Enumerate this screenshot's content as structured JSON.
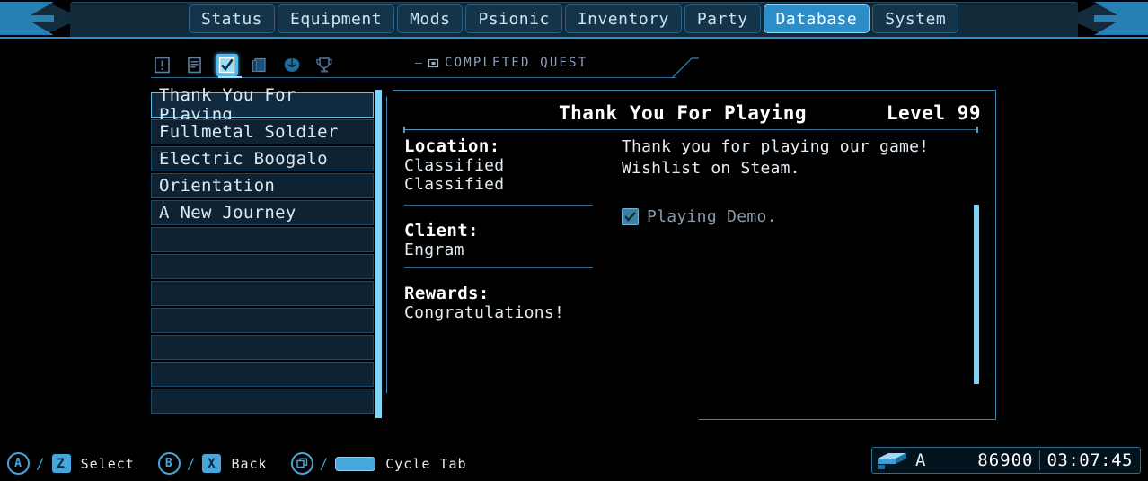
{
  "nav": {
    "tabs": [
      {
        "label": "Status",
        "active": false
      },
      {
        "label": "Equipment",
        "active": false
      },
      {
        "label": "Mods",
        "active": false
      },
      {
        "label": "Psionic",
        "active": false
      },
      {
        "label": "Inventory",
        "active": false
      },
      {
        "label": "Party",
        "active": false
      },
      {
        "label": "Database",
        "active": true
      },
      {
        "label": "System",
        "active": false
      }
    ]
  },
  "icon_tabs": [
    {
      "name": "alert-icon",
      "selected": false
    },
    {
      "name": "document-icon",
      "selected": false
    },
    {
      "name": "checkmark-icon",
      "selected": true
    },
    {
      "name": "codex-icon",
      "selected": false
    },
    {
      "name": "alien-icon",
      "selected": false
    },
    {
      "name": "trophy-icon",
      "selected": false
    }
  ],
  "section": {
    "header": "COMPLETED QUEST"
  },
  "quest_list": [
    {
      "label": "Thank You For Playing",
      "selected": true
    },
    {
      "label": "Fullmetal Soldier",
      "selected": false
    },
    {
      "label": "Electric Boogalo",
      "selected": false
    },
    {
      "label": "Orientation",
      "selected": false
    },
    {
      "label": "A New Journey",
      "selected": false
    },
    {
      "label": "",
      "selected": false
    },
    {
      "label": "",
      "selected": false
    },
    {
      "label": "",
      "selected": false
    },
    {
      "label": "",
      "selected": false
    },
    {
      "label": "",
      "selected": false
    },
    {
      "label": "",
      "selected": false
    },
    {
      "label": "",
      "selected": false
    }
  ],
  "detail": {
    "title": "Thank You For Playing",
    "level": "Level 99",
    "fields": [
      {
        "label": "Location:",
        "values": [
          "Classified",
          "Classified"
        ]
      },
      {
        "label": "Client:",
        "values": [
          "Engram"
        ]
      },
      {
        "label": "Rewards:",
        "values": [
          "Congratulations!"
        ]
      }
    ],
    "body": "Thank you for playing our game! Wishlist on Steam.",
    "objective": {
      "text": "Playing Demo.",
      "checked": true
    }
  },
  "footer": {
    "prompts": [
      {
        "pad": "A",
        "key": "Z",
        "label": "Select"
      },
      {
        "pad": "B",
        "key": "X",
        "label": "Back"
      },
      {
        "pad": "gamepad-shoulder-icon",
        "key": "space",
        "label": "Cycle Tab"
      }
    ],
    "hud": {
      "icon": "resource-block-icon",
      "currency_symbol": "A",
      "amount": "86900",
      "time": "03:07:45"
    }
  },
  "colors": {
    "accent": "#45a7dd",
    "accent_bright": "#7fd3f5",
    "panel": "#0d2233",
    "topbar": "#12293a"
  }
}
